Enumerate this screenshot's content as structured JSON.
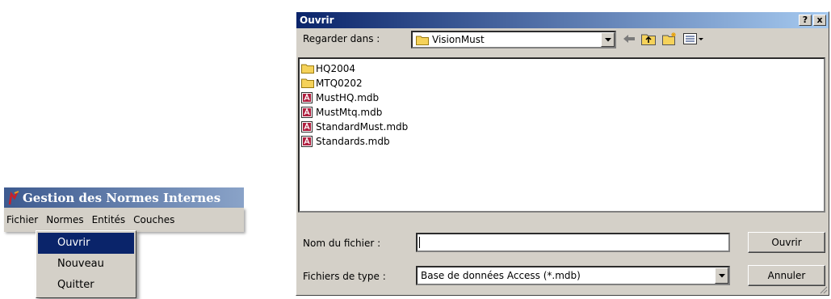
{
  "app": {
    "title": "Gestion des Normes Internes",
    "menu": [
      "Fichier",
      "Normes",
      "Entités",
      "Couches"
    ],
    "dropdown": [
      "Ouvrir",
      "Nouveau",
      "Quitter"
    ],
    "selected_dropdown_item": "Ouvrir"
  },
  "dialog": {
    "title": "Ouvrir",
    "help_button": "?",
    "close_button": "x",
    "look_in_label": "Regarder dans :",
    "look_in_value": "VisionMust",
    "toolbar_icons": [
      "back-arrow-icon",
      "up-folder-icon",
      "new-folder-icon",
      "view-menu-icon"
    ],
    "files": [
      {
        "name": "HQ2004",
        "type": "folder"
      },
      {
        "name": "MTQ0202",
        "type": "folder"
      },
      {
        "name": "MustHQ.mdb",
        "type": "access-db"
      },
      {
        "name": "MustMtq.mdb",
        "type": "access-db"
      },
      {
        "name": "StandardMust.mdb",
        "type": "access-db"
      },
      {
        "name": "Standards.mdb",
        "type": "access-db"
      }
    ],
    "filename_label": "Nom du fichier :",
    "filename_value": "",
    "filetype_label": "Fichiers de type :",
    "filetype_value": "Base de données Access (*.mdb)",
    "open_button": "Ouvrir",
    "cancel_button": "Annuler"
  },
  "colors": {
    "app_title_bg": "#3d5a8f",
    "dialog_title_bg": "#0a246a",
    "menu_selection": "#0a246a",
    "window_face": "#d4d0c8"
  }
}
